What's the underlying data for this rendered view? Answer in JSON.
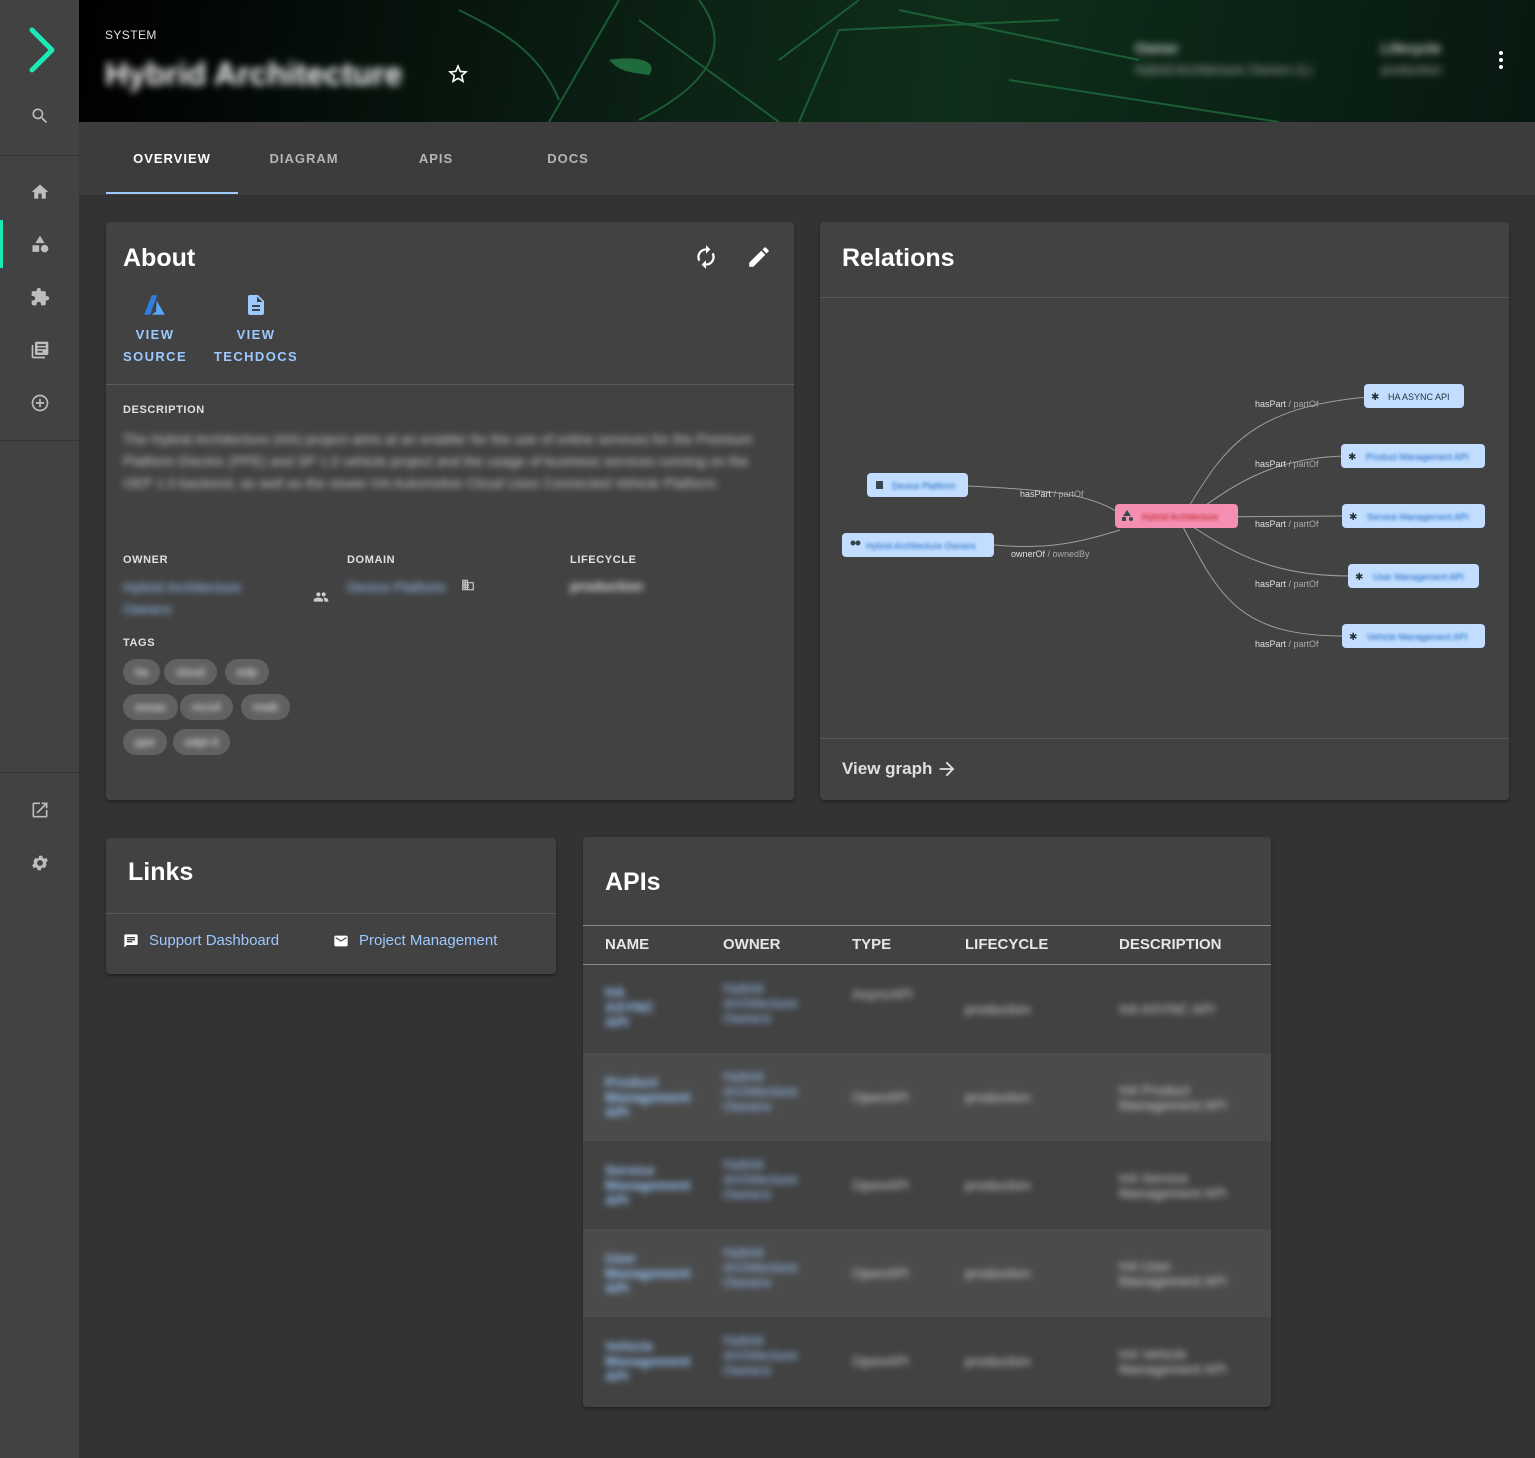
{
  "sidebar": {
    "logo": "chevron-logo",
    "items": [
      {
        "name": "search",
        "icon": "search-icon"
      },
      {
        "name": "home",
        "icon": "home-icon"
      },
      {
        "name": "catalog",
        "icon": "catalog-icon",
        "active": true
      },
      {
        "name": "apis",
        "icon": "puzzle-icon"
      },
      {
        "name": "docs",
        "icon": "library-icon"
      },
      {
        "name": "create",
        "icon": "add-circle-icon"
      },
      {
        "name": "external",
        "icon": "open-in-new-icon"
      },
      {
        "name": "settings",
        "icon": "gear-icon"
      }
    ],
    "accent": "#1de9b6"
  },
  "header": {
    "kind": "SYSTEM",
    "title": "Hybrid Architecture",
    "owner_label": "Owner",
    "owner_value": "Hybrid Architecture Owners (L)",
    "lifecycle_label": "Lifecycle",
    "lifecycle_value": "production"
  },
  "tabs": [
    "OVERVIEW",
    "DIAGRAM",
    "APIS",
    "DOCS"
  ],
  "about": {
    "title": "About",
    "view_source": [
      "VIEW",
      "SOURCE"
    ],
    "view_techdocs": [
      "VIEW",
      "TECHDOCS"
    ],
    "description_label": "DESCRIPTION",
    "description": "The Hybrid Architecture (HA) project aims at an enabler for the use of online services for the Premium Platform Electric (PPE) and SP 1.0 vehicle project and the usage of business services running on the OEP 1.0 backend, as well as the newer HA Automotive Cloud Uses Connected Vehicle Platform.",
    "owner_label": "OWNER",
    "owner_value": "Hybrid Architecture Owners",
    "domain_label": "DOMAIN",
    "domain_value": "Device Platform",
    "lifecycle_label": "LIFECYCLE",
    "lifecycle_value": "production",
    "tags_label": "TAGS",
    "tags": [
      "ha",
      "cloud",
      "edp",
      "sesac",
      "mcs4",
      "mwb",
      "ppe",
      "edpl-4"
    ]
  },
  "relations": {
    "title": "Relations",
    "view_graph": "View graph",
    "center_node": "Hybrid Architecture",
    "left_nodes": [
      {
        "label": "Device Platform",
        "edge": "hasPart",
        "edge_rev": "partOf",
        "icon": "domain-icon"
      },
      {
        "label": "Hybrid Architecture Owners",
        "edge": "ownerOf",
        "edge_rev": "ownedBy",
        "icon": "group-icon"
      }
    ],
    "right_nodes": [
      {
        "label": "HA ASYNC API",
        "edge": "hasPart",
        "edge_rev": "partOf"
      },
      {
        "label": "Product Management API",
        "edge": "hasPart",
        "edge_rev": "partOf"
      },
      {
        "label": "Service Management API",
        "edge": "hasPart",
        "edge_rev": "partOf"
      },
      {
        "label": "User Management API",
        "edge": "hasPart",
        "edge_rev": "partOf"
      },
      {
        "label": "Vehicle Management API",
        "edge": "hasPart",
        "edge_rev": "partOf"
      }
    ]
  },
  "links": {
    "title": "Links",
    "items": [
      {
        "label": "Support Dashboard",
        "icon": "chat-icon"
      },
      {
        "label": "Project Management",
        "icon": "mail-icon"
      }
    ]
  },
  "apis": {
    "title": "APIs",
    "columns": [
      "NAME",
      "OWNER",
      "TYPE",
      "LIFECYCLE",
      "DESCRIPTION"
    ],
    "rows": [
      {
        "name": "HA ASYNC API",
        "owner": "Hybrid Architecture Owners",
        "type": "AsyncAPI",
        "lifecycle": "production",
        "description": "HA ASYNC API"
      },
      {
        "name": "Product Management API",
        "owner": "Hybrid Architecture Owners",
        "type": "OpenAPI",
        "lifecycle": "production",
        "description": "HA Product Management API"
      },
      {
        "name": "Service Management API",
        "owner": "Hybrid Architecture Owners",
        "type": "OpenAPI",
        "lifecycle": "production",
        "description": "HA Service Management API"
      },
      {
        "name": "User Management API",
        "owner": "Hybrid Architecture Owners",
        "type": "OpenAPI",
        "lifecycle": "production",
        "description": "HA User Management API"
      },
      {
        "name": "Vehicle Management API",
        "owner": "Hybrid Architecture Owners",
        "type": "OpenAPI",
        "lifecycle": "production",
        "description": "HA Vehicle Management API"
      }
    ]
  },
  "colors": {
    "link": "#9cc9ff",
    "node_fill": "#c2ddff",
    "center_node_fill": "#f48fb1",
    "card": "#424242",
    "background": "#333333"
  }
}
